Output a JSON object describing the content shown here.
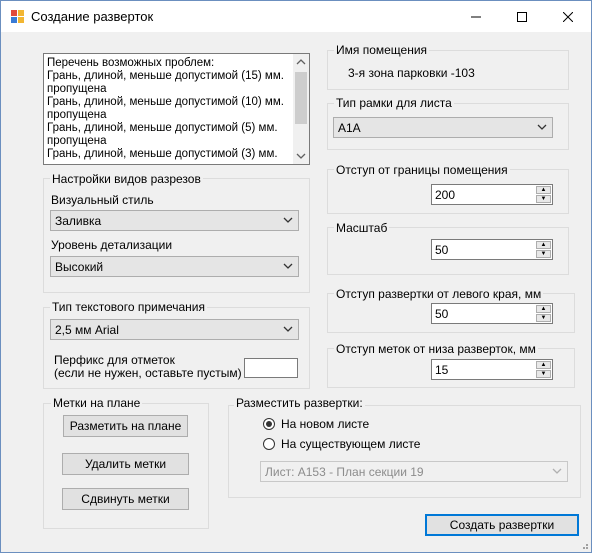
{
  "window": {
    "title": "Создание разверток",
    "minimize": "—",
    "maximize": "☐",
    "close": "✕"
  },
  "problems": {
    "lines": [
      "Перечень возможных проблем:",
      "Грань, длиной, меньше допустимой (15) мм.",
      "пропущена",
      "Грань, длиной, меньше допустимой (10) мм.",
      "пропущена",
      "Грань, длиной, меньше допустимой (5) мм.",
      "пропущена",
      "Грань, длиной, меньше допустимой (3) мм."
    ]
  },
  "views": {
    "group_label": "Настройки видов разрезов",
    "visual_style_label": "Визуальный стиль",
    "visual_style_value": "Заливка",
    "detail_label": "Уровень детализации",
    "detail_value": "Высокий"
  },
  "text_note": {
    "group_label": "Тип текстового примечания",
    "value": "2,5 мм Arial",
    "prefix_label_1": "Перфикс для отметок",
    "prefix_label_2": "(если не нужен, оставьте пустым)",
    "prefix_value": ""
  },
  "marks": {
    "group_label": "Метки на плане",
    "place_button": "Разметить на плане",
    "delete_button": "Удалить метки",
    "shift_button": "Сдвинуть метки"
  },
  "room": {
    "label": "Имя помещения",
    "value": "3-я зона парковки -103"
  },
  "frame": {
    "label": "Тип рамки для листа",
    "value": "А1А"
  },
  "offset": {
    "label": "Отступ от границы помещения",
    "value": "200"
  },
  "scale": {
    "label": "Масштаб",
    "value": "50"
  },
  "left_offset": {
    "label": "Отступ развертки от левого края, мм",
    "value": "50"
  },
  "bottom_offset": {
    "label": "Отступ меток от низа разверток, мм",
    "value": "15"
  },
  "placement": {
    "label": "Разместить развертки:",
    "new_sheet": "На новом листе",
    "existing_sheet": "На существующем листе",
    "sheet_value": "Лист: А153 - План секции 19",
    "selected": "new_sheet"
  },
  "create_button": "Создать развертки"
}
